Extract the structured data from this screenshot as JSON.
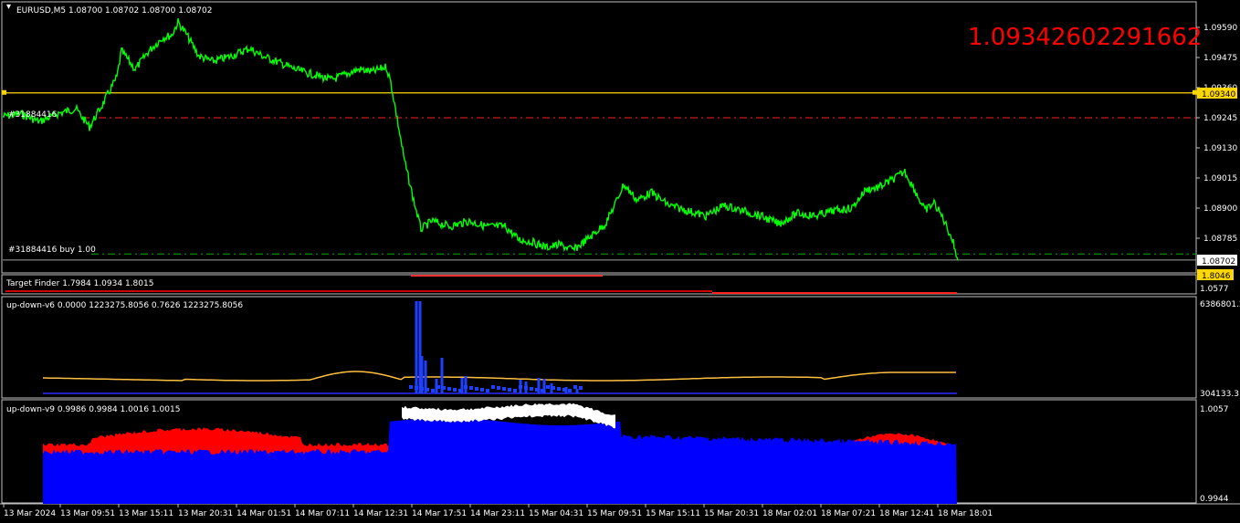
{
  "main": {
    "title": "EURUSD,M5  1.08700 1.08702 1.08700 1.08702",
    "big_value": "1.09342602291662",
    "label_sell": "#31884416",
    "label_buy": "#31884416 buy 1.00",
    "price_ticks": [
      "1.09590",
      "1.09475",
      "1.09360",
      "1.09245",
      "1.09130",
      "1.09015",
      "1.08900",
      "1.08785"
    ],
    "price_values": [
      1.0959,
      1.09475,
      1.0936,
      1.09245,
      1.0913,
      1.09015,
      1.089,
      1.08785
    ],
    "tag_yellow": "1.09340",
    "tag_current": "1.08702",
    "yellow_level": 1.0934,
    "red_dash_level": 1.09245,
    "green_dash_level": 1.08725,
    "gray_level": 1.08702,
    "colors": {
      "price": "#00ff00",
      "yellow": "#ffd700",
      "red": "#ff2020",
      "blue": "#0000ff",
      "orange": "#ffc040"
    }
  },
  "target_finder": {
    "label": "Target Finder 1.7984 1.0934 1.8015",
    "tag": "1.8046",
    "tick": "1.0577"
  },
  "updown6": {
    "label": "up-down-v6 0.0000 1223275.8056 0.7626 1223275.8056",
    "tick_top": "6386801.2",
    "tick_bottom": "304133.3"
  },
  "updown9": {
    "label": "up-down-v9 0.9986 0.9984 1.0016 1.0015",
    "tick_top": "1.0057",
    "tick_bottom": "0.9944"
  },
  "time_axis": [
    "13 Mar 2024",
    "13 Mar 09:51",
    "13 Mar 15:11",
    "13 Mar 20:31",
    "14 Mar 01:51",
    "14 Mar 07:11",
    "14 Mar 12:31",
    "14 Mar 17:51",
    "14 Mar 23:11",
    "15 Mar 04:31",
    "15 Mar 09:51",
    "15 Mar 15:11",
    "15 Mar 20:31",
    "18 Mar 02:01",
    "18 Mar 07:21",
    "18 Mar 12:41",
    "18 Mar 18:01"
  ],
  "price_series": [
    [
      0,
      1.0925
    ],
    [
      20,
      1.0926
    ],
    [
      40,
      1.0923
    ],
    [
      60,
      1.0926
    ],
    [
      80,
      1.0928
    ],
    [
      95,
      1.0921
    ],
    [
      110,
      1.093
    ],
    [
      125,
      1.094
    ],
    [
      130,
      1.095
    ],
    [
      145,
      1.0943
    ],
    [
      160,
      1.095
    ],
    [
      175,
      1.0955
    ],
    [
      185,
      1.0956
    ],
    [
      192,
      1.0961
    ],
    [
      200,
      1.0957
    ],
    [
      215,
      1.0948
    ],
    [
      230,
      1.0946
    ],
    [
      250,
      1.0948
    ],
    [
      270,
      1.0951
    ],
    [
      285,
      1.0948
    ],
    [
      300,
      1.0946
    ],
    [
      320,
      1.0943
    ],
    [
      340,
      1.0941
    ],
    [
      360,
      1.0939
    ],
    [
      375,
      1.0941
    ],
    [
      390,
      1.0943
    ],
    [
      405,
      1.0942
    ],
    [
      420,
      1.0944
    ],
    [
      425,
      1.0938
    ],
    [
      430,
      1.0928
    ],
    [
      440,
      1.0908
    ],
    [
      450,
      1.0893
    ],
    [
      458,
      1.0882
    ],
    [
      470,
      1.0885
    ],
    [
      490,
      1.0883
    ],
    [
      510,
      1.0885
    ],
    [
      530,
      1.0883
    ],
    [
      550,
      1.0883
    ],
    [
      565,
      1.0878
    ],
    [
      580,
      1.0877
    ],
    [
      595,
      1.0875
    ],
    [
      610,
      1.0876
    ],
    [
      625,
      1.0874
    ],
    [
      640,
      1.0878
    ],
    [
      660,
      1.0884
    ],
    [
      670,
      1.0891
    ],
    [
      680,
      1.0899
    ],
    [
      695,
      1.0893
    ],
    [
      710,
      1.0896
    ],
    [
      730,
      1.0891
    ],
    [
      750,
      1.0889
    ],
    [
      770,
      1.0887
    ],
    [
      790,
      1.0891
    ],
    [
      810,
      1.0889
    ],
    [
      830,
      1.0887
    ],
    [
      850,
      1.0884
    ],
    [
      870,
      1.0888
    ],
    [
      890,
      1.0887
    ],
    [
      910,
      1.0889
    ],
    [
      930,
      1.089
    ],
    [
      945,
      1.0897
    ],
    [
      960,
      1.0898
    ],
    [
      975,
      1.0901
    ],
    [
      988,
      1.0904
    ],
    [
      1000,
      1.0896
    ],
    [
      1010,
      1.0889
    ],
    [
      1020,
      1.0892
    ],
    [
      1030,
      1.0886
    ],
    [
      1040,
      1.0878
    ],
    [
      1046,
      1.087
    ]
  ]
}
